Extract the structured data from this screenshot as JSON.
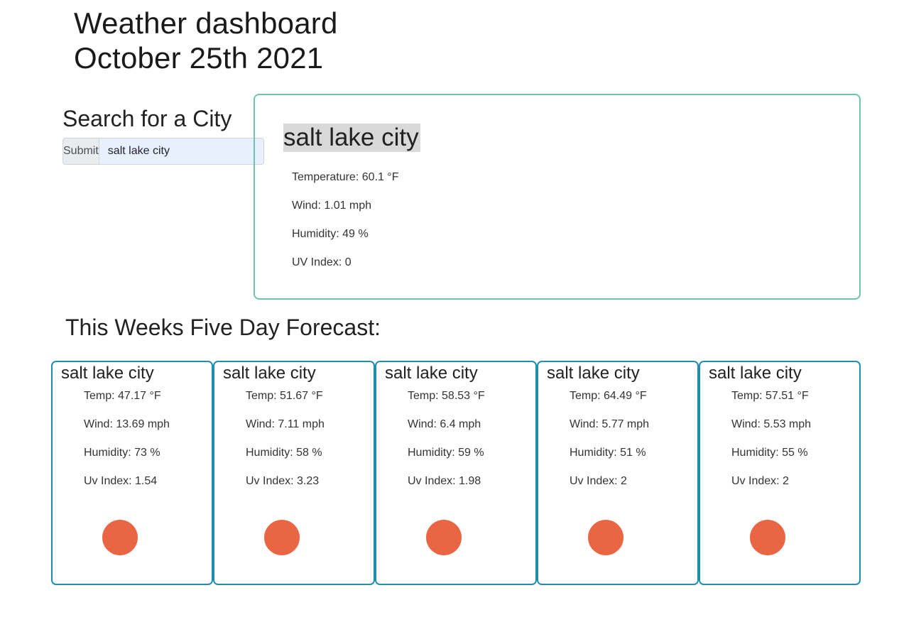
{
  "header": {
    "title": "Weather dashboard",
    "date": "October 25th 2021"
  },
  "search": {
    "title": "Search for a City",
    "submit_label": "Submit",
    "input_value": "salt lake city"
  },
  "current": {
    "city": "salt lake city",
    "temperature": "Temperature: 60.1 °F",
    "wind": "Wind: 1.01 mph",
    "humidity": "Humidity: 49 %",
    "uv_index": "UV Index: 0"
  },
  "forecast": {
    "heading": "This Weeks Five Day Forecast:",
    "icon_color": "#e96544",
    "border_color": "#1f8fb0",
    "days": [
      {
        "city": "salt lake city",
        "temp": "Temp: 47.17 °F",
        "wind": "Wind: 13.69 mph",
        "humidity": "Humidity: 73 %",
        "uv": "Uv Index: 1.54",
        "icon": "sun-icon"
      },
      {
        "city": "salt lake city",
        "temp": "Temp: 51.67 °F",
        "wind": "Wind: 7.11 mph",
        "humidity": "Humidity: 58 %",
        "uv": "Uv Index: 3.23",
        "icon": "sun-icon"
      },
      {
        "city": "salt lake city",
        "temp": "Temp: 58.53 °F",
        "wind": "Wind: 6.4 mph",
        "humidity": "Humidity: 59 %",
        "uv": "Uv Index: 1.98",
        "icon": "sun-icon"
      },
      {
        "city": "salt lake city",
        "temp": "Temp: 64.49 °F",
        "wind": "Wind: 5.77 mph",
        "humidity": "Humidity: 51 %",
        "uv": "Uv Index: 2",
        "icon": "sun-icon"
      },
      {
        "city": "salt lake city",
        "temp": "Temp: 57.51 °F",
        "wind": "Wind: 5.53 mph",
        "humidity": "Humidity: 55 %",
        "uv": "Uv Index: 2",
        "icon": "sun-icon"
      }
    ]
  },
  "colors": {
    "current_card_border": "#6cc3b1",
    "highlight_bg": "#d9d9d9",
    "input_bg": "#e8f0fe"
  }
}
